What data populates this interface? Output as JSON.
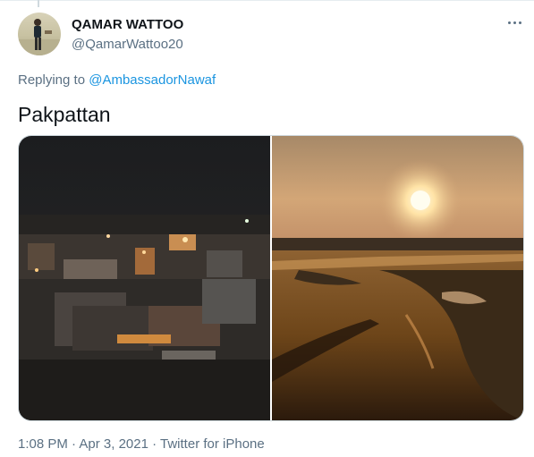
{
  "author": {
    "name": "QAMAR WATTOO",
    "handle": "@QamarWattoo20"
  },
  "reply": {
    "prefix": "Replying to ",
    "mention": "@AmbassadorNawaf"
  },
  "tweet": {
    "text": "Pakpattan"
  },
  "media": {
    "photos": [
      {
        "subject": "night cityscape with lights"
      },
      {
        "subject": "sunset over river"
      }
    ]
  },
  "meta": {
    "time": "1:08 PM",
    "separator": " · ",
    "date": "Apr 3, 2021",
    "source": "Twitter for iPhone"
  },
  "icons": {
    "more": "more-horizontal-icon"
  },
  "colors": {
    "text_primary": "#0f1419",
    "text_secondary": "#5b7083",
    "link": "#1b95e0",
    "border": "#cfd9de"
  }
}
